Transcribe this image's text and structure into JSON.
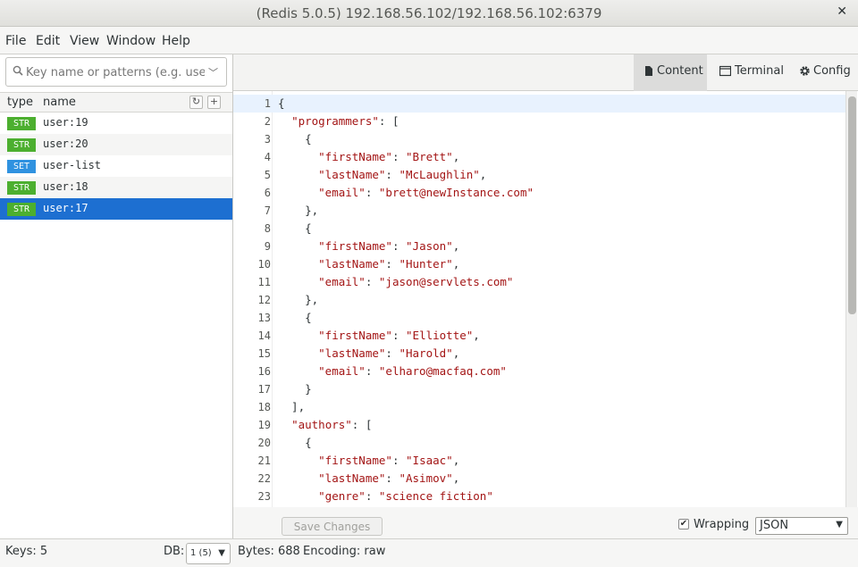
{
  "window": {
    "title": "(Redis 5.0.5) 192.168.56.102/192.168.56.102:6379",
    "close_glyph": "✕"
  },
  "menu": [
    "File",
    "Edit",
    "View",
    "Window",
    "Help"
  ],
  "search": {
    "placeholder": "Key name or patterns (e.g. user:*)",
    "icon": "search-icon"
  },
  "key_list": {
    "headers": {
      "type": "type",
      "name": "name"
    },
    "refresh_icon": "↻",
    "add_icon": "+",
    "items": [
      {
        "type": "STR",
        "name": "user:19",
        "color": "#4caf2f"
      },
      {
        "type": "STR",
        "name": "user:20",
        "color": "#4caf2f"
      },
      {
        "type": "SET",
        "name": "user-list",
        "color": "#2f92e0"
      },
      {
        "type": "STR",
        "name": "user:18",
        "color": "#4caf2f"
      },
      {
        "type": "STR",
        "name": "user:17",
        "color": "#4caf2f",
        "selected": true
      }
    ]
  },
  "tabs": [
    {
      "label": "Content",
      "icon": "document-icon",
      "active": true
    },
    {
      "label": "Terminal",
      "icon": "terminal-icon",
      "active": false
    },
    {
      "label": "Config",
      "icon": "gear-icon",
      "active": false
    }
  ],
  "editor": {
    "lines": [
      [
        [
          "p",
          "{"
        ]
      ],
      [
        [
          "p",
          "  "
        ],
        [
          "s",
          "\"programmers\""
        ],
        [
          "p",
          ": ["
        ]
      ],
      [
        [
          "p",
          "    {"
        ]
      ],
      [
        [
          "p",
          "      "
        ],
        [
          "s",
          "\"firstName\""
        ],
        [
          "p",
          ": "
        ],
        [
          "s",
          "\"Brett\""
        ],
        [
          "p",
          ","
        ]
      ],
      [
        [
          "p",
          "      "
        ],
        [
          "s",
          "\"lastName\""
        ],
        [
          "p",
          ": "
        ],
        [
          "s",
          "\"McLaughlin\""
        ],
        [
          "p",
          ","
        ]
      ],
      [
        [
          "p",
          "      "
        ],
        [
          "s",
          "\"email\""
        ],
        [
          "p",
          ": "
        ],
        [
          "s",
          "\"brett@newInstance.com\""
        ]
      ],
      [
        [
          "p",
          "    },"
        ]
      ],
      [
        [
          "p",
          "    {"
        ]
      ],
      [
        [
          "p",
          "      "
        ],
        [
          "s",
          "\"firstName\""
        ],
        [
          "p",
          ": "
        ],
        [
          "s",
          "\"Jason\""
        ],
        [
          "p",
          ","
        ]
      ],
      [
        [
          "p",
          "      "
        ],
        [
          "s",
          "\"lastName\""
        ],
        [
          "p",
          ": "
        ],
        [
          "s",
          "\"Hunter\""
        ],
        [
          "p",
          ","
        ]
      ],
      [
        [
          "p",
          "      "
        ],
        [
          "s",
          "\"email\""
        ],
        [
          "p",
          ": "
        ],
        [
          "s",
          "\"jason@servlets.com\""
        ]
      ],
      [
        [
          "p",
          "    },"
        ]
      ],
      [
        [
          "p",
          "    {"
        ]
      ],
      [
        [
          "p",
          "      "
        ],
        [
          "s",
          "\"firstName\""
        ],
        [
          "p",
          ": "
        ],
        [
          "s",
          "\"Elliotte\""
        ],
        [
          "p",
          ","
        ]
      ],
      [
        [
          "p",
          "      "
        ],
        [
          "s",
          "\"lastName\""
        ],
        [
          "p",
          ": "
        ],
        [
          "s",
          "\"Harold\""
        ],
        [
          "p",
          ","
        ]
      ],
      [
        [
          "p",
          "      "
        ],
        [
          "s",
          "\"email\""
        ],
        [
          "p",
          ": "
        ],
        [
          "s",
          "\"elharo@macfaq.com\""
        ]
      ],
      [
        [
          "p",
          "    }"
        ]
      ],
      [
        [
          "p",
          "  ],"
        ]
      ],
      [
        [
          "p",
          "  "
        ],
        [
          "s",
          "\"authors\""
        ],
        [
          "p",
          ": ["
        ]
      ],
      [
        [
          "p",
          "    {"
        ]
      ],
      [
        [
          "p",
          "      "
        ],
        [
          "s",
          "\"firstName\""
        ],
        [
          "p",
          ": "
        ],
        [
          "s",
          "\"Isaac\""
        ],
        [
          "p",
          ","
        ]
      ],
      [
        [
          "p",
          "      "
        ],
        [
          "s",
          "\"lastName\""
        ],
        [
          "p",
          ": "
        ],
        [
          "s",
          "\"Asimov\""
        ],
        [
          "p",
          ","
        ]
      ],
      [
        [
          "p",
          "      "
        ],
        [
          "s",
          "\"genre\""
        ],
        [
          "p",
          ": "
        ],
        [
          "s",
          "\"science fiction\""
        ]
      ],
      [
        [
          "p",
          "    },"
        ]
      ],
      [
        [
          "p",
          "    {"
        ]
      ]
    ],
    "save_label": "Save Changes",
    "wrap_label": "Wrapping",
    "wrap_checked": true,
    "format": "JSON"
  },
  "status": {
    "keys": "Keys: 5",
    "db_label": "DB:",
    "db_value": "1 (5)",
    "bytes": "Bytes: 688",
    "encoding": "Encoding: raw"
  }
}
